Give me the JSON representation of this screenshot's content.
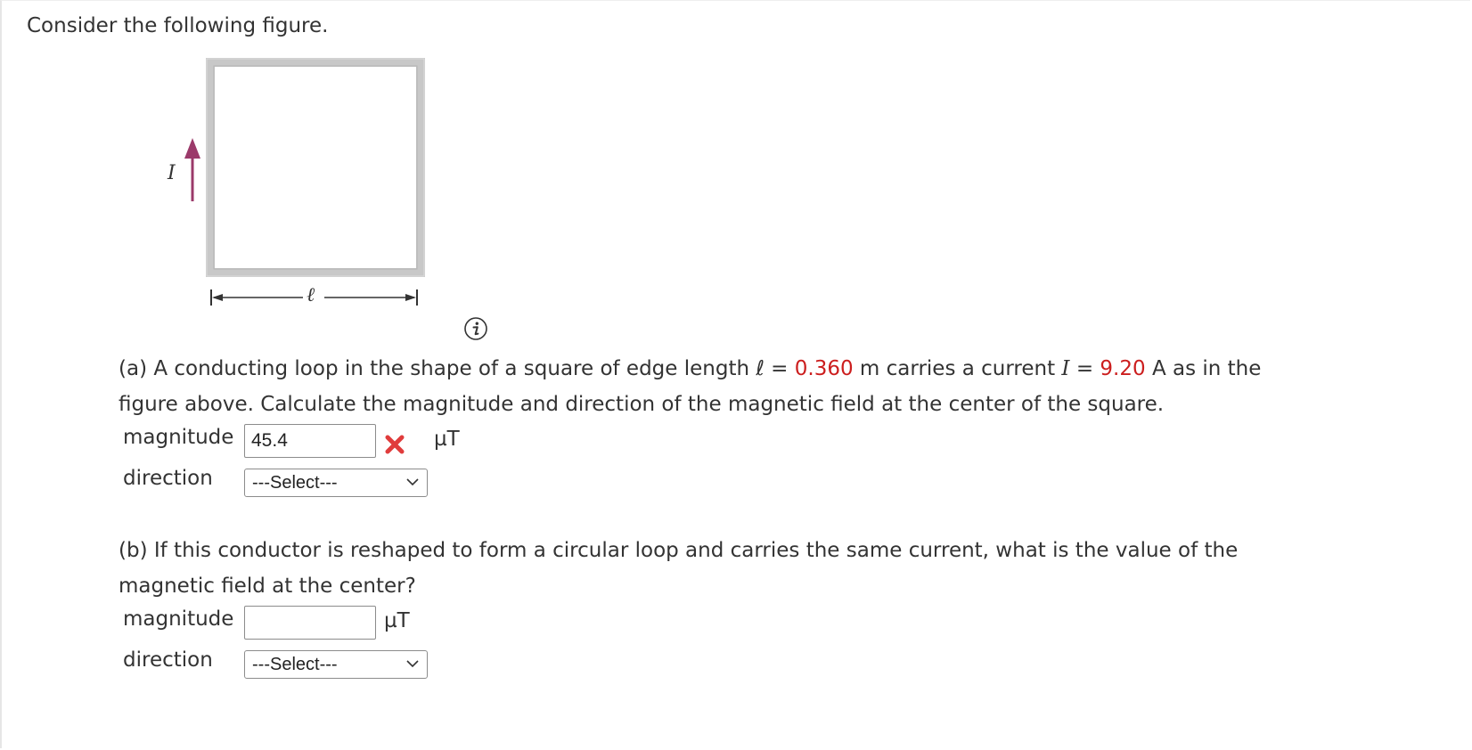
{
  "intro": "Consider the following figure.",
  "figure": {
    "current_label": "I",
    "length_label": "ℓ",
    "arrow_color": "#9b3a6a"
  },
  "info_icon": "info-icon",
  "part_a": {
    "text1": "(a) A conducting loop in the shape of a square of edge length ℓ = ",
    "length_value": "0.360",
    "text2": " m carries a current ",
    "current_symbol": "I",
    "text3": " = ",
    "current_value": "9.20",
    "text4": " A as in the",
    "line2": "figure above. Calculate the magnitude and direction of the magnetic field at the center of the square.",
    "magnitude_label": "magnitude",
    "magnitude_value": "45.4",
    "unit": "µT",
    "direction_label": "direction",
    "direction_value": "---Select---",
    "status_icon": "x-mark-icon",
    "status_color": "#e03c3c"
  },
  "part_b": {
    "line1": "(b) If this conductor is reshaped to form a circular loop and carries the same current, what is the value of the",
    "line2": "magnetic field at the center?",
    "magnitude_label": "magnitude",
    "magnitude_value": "",
    "unit": "µT",
    "direction_label": "direction",
    "direction_value": "---Select---"
  },
  "colors": {
    "highlight": "#cc1e1e",
    "text": "#333333"
  }
}
